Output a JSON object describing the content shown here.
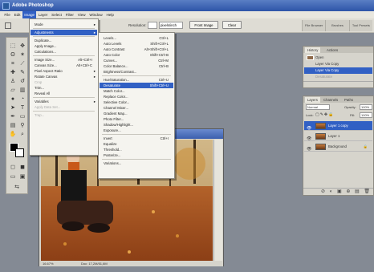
{
  "app": {
    "title": "Adobe Photoshop"
  },
  "menubar": [
    "File",
    "Edit",
    "Image",
    "Layer",
    "Select",
    "Filter",
    "View",
    "Window",
    "Help"
  ],
  "options": {
    "resolution_label": "Resolution:",
    "resolution_unit": "pixels/inch",
    "front_image": "Front Image",
    "clear": "Clear",
    "wells": [
      "File Browser",
      "Brushes",
      "Tool Presets"
    ]
  },
  "image_menu": [
    {
      "label": "Mode",
      "arrow": "▸"
    },
    {
      "sep": true
    },
    {
      "label": "Adjustments",
      "arrow": "▸",
      "highlight": true
    },
    {
      "sep": true
    },
    {
      "label": "Duplicate..."
    },
    {
      "label": "Apply Image..."
    },
    {
      "label": "Calculations..."
    },
    {
      "sep": true
    },
    {
      "label": "Image Size...",
      "shortcut": "Alt+Ctrl+I"
    },
    {
      "label": "Canvas Size...",
      "shortcut": "Alt+Ctrl+C"
    },
    {
      "label": "Pixel Aspect Ratio",
      "arrow": "▸"
    },
    {
      "label": "Rotate Canvas",
      "arrow": "▸"
    },
    {
      "label": "Crop",
      "disabled": true
    },
    {
      "label": "Trim..."
    },
    {
      "label": "Reveal All"
    },
    {
      "sep": true
    },
    {
      "label": "Variables",
      "arrow": "▸"
    },
    {
      "label": "Apply Data Set...",
      "disabled": true
    },
    {
      "sep": true
    },
    {
      "label": "Trap...",
      "disabled": true
    }
  ],
  "adjustments_menu": [
    {
      "label": "Levels...",
      "shortcut": "Ctrl+L"
    },
    {
      "label": "Auto Levels",
      "shortcut": "Shift+Ctrl+L"
    },
    {
      "label": "Auto Contrast",
      "shortcut": "Alt+Shift+Ctrl+L"
    },
    {
      "label": "Auto Color",
      "shortcut": "Shift+Ctrl+B"
    },
    {
      "label": "Curves...",
      "shortcut": "Ctrl+M"
    },
    {
      "label": "Color Balance...",
      "shortcut": "Ctrl+B"
    },
    {
      "label": "Brightness/Contrast..."
    },
    {
      "sep": true
    },
    {
      "label": "Hue/Saturation...",
      "shortcut": "Ctrl+U"
    },
    {
      "label": "Desaturate",
      "shortcut": "Shift+Ctrl+U",
      "highlight": true
    },
    {
      "label": "Match Color..."
    },
    {
      "label": "Replace Color..."
    },
    {
      "label": "Selective Color..."
    },
    {
      "label": "Channel Mixer..."
    },
    {
      "label": "Gradient Map..."
    },
    {
      "label": "Photo Filter..."
    },
    {
      "label": "Shadow/Highlight..."
    },
    {
      "label": "Exposure..."
    },
    {
      "sep": true
    },
    {
      "label": "Invert",
      "shortcut": "Ctrl+I"
    },
    {
      "label": "Equalize"
    },
    {
      "label": "Threshold..."
    },
    {
      "label": "Posterize..."
    },
    {
      "sep": true
    },
    {
      "label": "Variations..."
    }
  ],
  "history_panel": {
    "tabs": [
      "History",
      "Actions"
    ],
    "items": [
      {
        "label": "Open"
      },
      {
        "label": "Layer Via Copy"
      },
      {
        "label": "Layer Via Copy",
        "highlight": true
      },
      {
        "label": "Desaturate",
        "disabled": true
      }
    ]
  },
  "layers_panel": {
    "tabs": [
      "Layers",
      "Channels",
      "Paths"
    ],
    "blend_mode": "Normal",
    "opacity_label": "Opacity:",
    "opacity": "100%",
    "lock_label": "Lock:",
    "fill_label": "Fill:",
    "fill": "100%",
    "layers": [
      {
        "name": "Layer 1 copy",
        "highlight": true
      },
      {
        "name": "Layer 1"
      },
      {
        "name": "Background",
        "locked": true
      }
    ],
    "footer": "⊘ ◐ ▣ ⊕ ▤ 🗑"
  },
  "document": {
    "zoom": "16.67%",
    "doc_info": "Doc: 17,2M/51,6M"
  },
  "colors": {
    "workspace": "#848a94",
    "highlight": "#3160c4"
  }
}
